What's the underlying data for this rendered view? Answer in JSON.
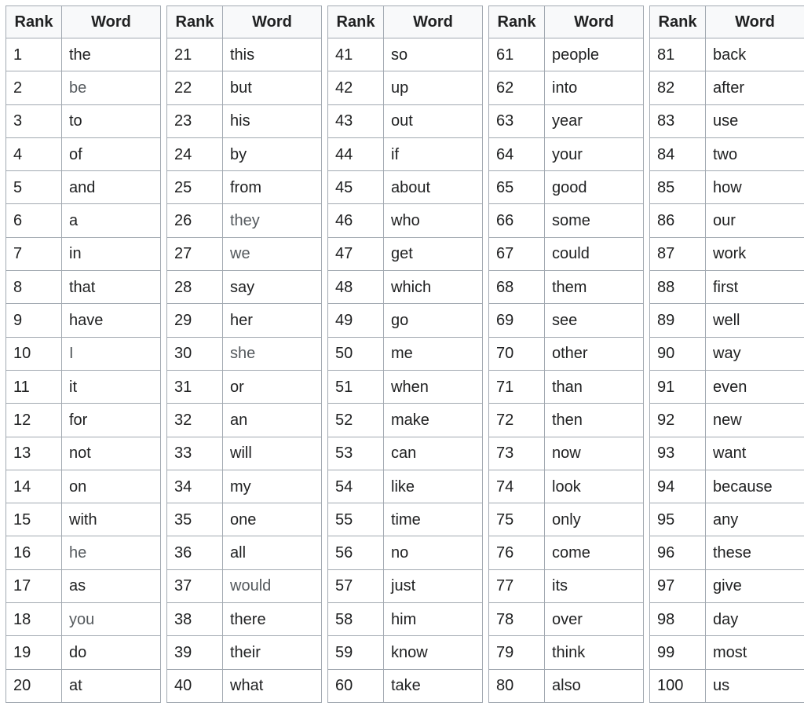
{
  "headers": {
    "rank": "Rank",
    "word": "Word"
  },
  "colors": {
    "header_bg": "#f8f9fa",
    "border": "#a2a9b1",
    "text": "#202122",
    "link_text": "#54595d"
  },
  "tables": [
    {
      "rows": [
        {
          "rank": "1",
          "word": "the"
        },
        {
          "rank": "2",
          "word": "be",
          "link": true
        },
        {
          "rank": "3",
          "word": "to"
        },
        {
          "rank": "4",
          "word": "of"
        },
        {
          "rank": "5",
          "word": "and"
        },
        {
          "rank": "6",
          "word": "a"
        },
        {
          "rank": "7",
          "word": "in"
        },
        {
          "rank": "8",
          "word": "that"
        },
        {
          "rank": "9",
          "word": "have"
        },
        {
          "rank": "10",
          "word": "I",
          "link": true
        },
        {
          "rank": "11",
          "word": "it"
        },
        {
          "rank": "12",
          "word": "for"
        },
        {
          "rank": "13",
          "word": "not"
        },
        {
          "rank": "14",
          "word": "on"
        },
        {
          "rank": "15",
          "word": "with"
        },
        {
          "rank": "16",
          "word": "he",
          "link": true
        },
        {
          "rank": "17",
          "word": "as"
        },
        {
          "rank": "18",
          "word": "you",
          "link": true
        },
        {
          "rank": "19",
          "word": "do"
        },
        {
          "rank": "20",
          "word": "at"
        }
      ]
    },
    {
      "rows": [
        {
          "rank": "21",
          "word": "this"
        },
        {
          "rank": "22",
          "word": "but"
        },
        {
          "rank": "23",
          "word": "his"
        },
        {
          "rank": "24",
          "word": "by"
        },
        {
          "rank": "25",
          "word": "from"
        },
        {
          "rank": "26",
          "word": "they",
          "link": true
        },
        {
          "rank": "27",
          "word": "we",
          "link": true
        },
        {
          "rank": "28",
          "word": "say"
        },
        {
          "rank": "29",
          "word": "her"
        },
        {
          "rank": "30",
          "word": "she",
          "link": true
        },
        {
          "rank": "31",
          "word": "or"
        },
        {
          "rank": "32",
          "word": "an"
        },
        {
          "rank": "33",
          "word": "will"
        },
        {
          "rank": "34",
          "word": "my"
        },
        {
          "rank": "35",
          "word": "one"
        },
        {
          "rank": "36",
          "word": "all"
        },
        {
          "rank": "37",
          "word": "would",
          "link": true
        },
        {
          "rank": "38",
          "word": "there"
        },
        {
          "rank": "39",
          "word": "their"
        },
        {
          "rank": "40",
          "word": "what"
        }
      ]
    },
    {
      "rows": [
        {
          "rank": "41",
          "word": "so"
        },
        {
          "rank": "42",
          "word": "up"
        },
        {
          "rank": "43",
          "word": "out"
        },
        {
          "rank": "44",
          "word": "if"
        },
        {
          "rank": "45",
          "word": "about"
        },
        {
          "rank": "46",
          "word": "who"
        },
        {
          "rank": "47",
          "word": "get"
        },
        {
          "rank": "48",
          "word": "which"
        },
        {
          "rank": "49",
          "word": "go"
        },
        {
          "rank": "50",
          "word": "me"
        },
        {
          "rank": "51",
          "word": "when"
        },
        {
          "rank": "52",
          "word": "make"
        },
        {
          "rank": "53",
          "word": "can"
        },
        {
          "rank": "54",
          "word": "like"
        },
        {
          "rank": "55",
          "word": "time"
        },
        {
          "rank": "56",
          "word": "no"
        },
        {
          "rank": "57",
          "word": "just"
        },
        {
          "rank": "58",
          "word": "him"
        },
        {
          "rank": "59",
          "word": "know"
        },
        {
          "rank": "60",
          "word": "take"
        }
      ]
    },
    {
      "rows": [
        {
          "rank": "61",
          "word": "people"
        },
        {
          "rank": "62",
          "word": "into"
        },
        {
          "rank": "63",
          "word": "year"
        },
        {
          "rank": "64",
          "word": "your"
        },
        {
          "rank": "65",
          "word": "good"
        },
        {
          "rank": "66",
          "word": "some"
        },
        {
          "rank": "67",
          "word": "could"
        },
        {
          "rank": "68",
          "word": "them"
        },
        {
          "rank": "69",
          "word": "see"
        },
        {
          "rank": "70",
          "word": "other"
        },
        {
          "rank": "71",
          "word": "than"
        },
        {
          "rank": "72",
          "word": "then"
        },
        {
          "rank": "73",
          "word": "now"
        },
        {
          "rank": "74",
          "word": "look"
        },
        {
          "rank": "75",
          "word": "only"
        },
        {
          "rank": "76",
          "word": "come"
        },
        {
          "rank": "77",
          "word": "its"
        },
        {
          "rank": "78",
          "word": "over"
        },
        {
          "rank": "79",
          "word": "think"
        },
        {
          "rank": "80",
          "word": "also"
        }
      ]
    },
    {
      "rows": [
        {
          "rank": "81",
          "word": "back"
        },
        {
          "rank": "82",
          "word": "after"
        },
        {
          "rank": "83",
          "word": "use"
        },
        {
          "rank": "84",
          "word": "two"
        },
        {
          "rank": "85",
          "word": "how"
        },
        {
          "rank": "86",
          "word": "our"
        },
        {
          "rank": "87",
          "word": "work"
        },
        {
          "rank": "88",
          "word": "first"
        },
        {
          "rank": "89",
          "word": "well"
        },
        {
          "rank": "90",
          "word": "way"
        },
        {
          "rank": "91",
          "word": "even"
        },
        {
          "rank": "92",
          "word": "new"
        },
        {
          "rank": "93",
          "word": "want"
        },
        {
          "rank": "94",
          "word": "because"
        },
        {
          "rank": "95",
          "word": "any"
        },
        {
          "rank": "96",
          "word": "these"
        },
        {
          "rank": "97",
          "word": "give"
        },
        {
          "rank": "98",
          "word": "day"
        },
        {
          "rank": "99",
          "word": "most"
        },
        {
          "rank": "100",
          "word": "us"
        }
      ]
    }
  ]
}
